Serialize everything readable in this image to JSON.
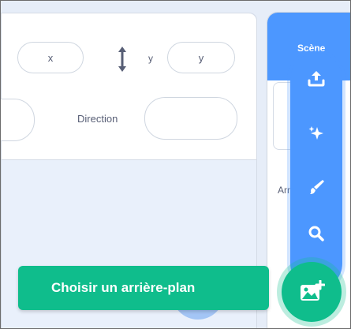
{
  "sprite_info": {
    "x_field": {
      "value": "x"
    },
    "y_label": "y",
    "y_field": {
      "value": "y"
    },
    "direction_label": "Direction"
  },
  "stage": {
    "title": "Scène",
    "backdrops_text": "Arrière-plans"
  },
  "backdrop_menu": {
    "items": [
      {
        "icon": "upload-icon"
      },
      {
        "icon": "surprise-icon"
      },
      {
        "icon": "paint-icon"
      },
      {
        "icon": "search-icon"
      }
    ],
    "main_button": {
      "icon": "choose-backdrop-icon"
    },
    "tooltip": "Choisir un arrière-plan"
  },
  "colors": {
    "stage_blue": "#4c97ff",
    "action_green": "#0fbd8c",
    "text_gray": "#575e75"
  }
}
